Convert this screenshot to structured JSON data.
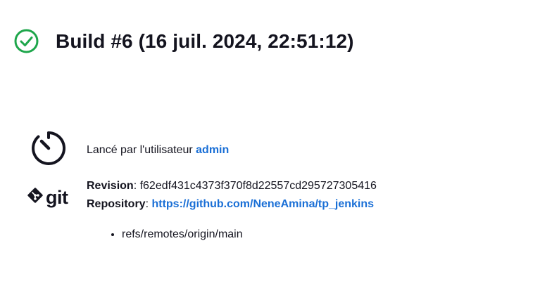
{
  "build": {
    "title": "Build #6 (16 juil. 2024, 22:51:12)",
    "status": "success",
    "status_color": "#1ea64b"
  },
  "cause": {
    "prefix": "Lancé par l'utilisateur ",
    "user_link": "admin"
  },
  "git": {
    "logo_text": "git",
    "revision_label": "Revision",
    "revision_sep": ": ",
    "revision_value": "f62edf431c4373f370f8d22557cd295727305416",
    "repository_label": "Repository",
    "repository_sep": ": ",
    "repository_link": "https://github.com/NeneAmina/tp_jenkins",
    "branches": [
      "refs/remotes/origin/main"
    ]
  },
  "colors": {
    "link": "#1a6fd6",
    "text": "#14141f",
    "success": "#1ea64b"
  },
  "icons": {
    "status": "check-circle-icon",
    "timer": "timer-icon",
    "git": "git-logo-icon"
  }
}
